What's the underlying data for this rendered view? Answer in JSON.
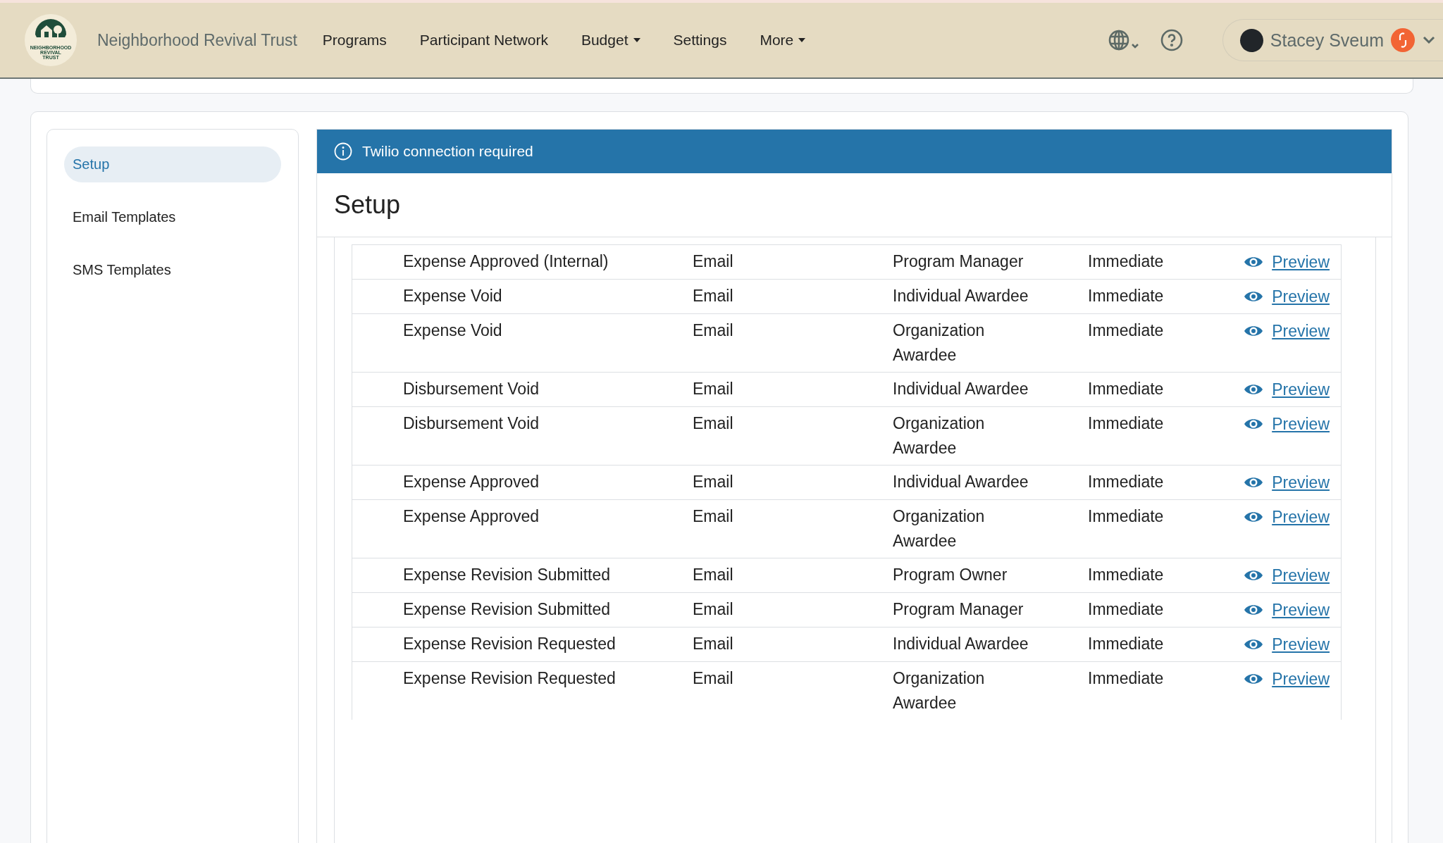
{
  "header": {
    "org_name": "Neighborhood Revival Trust",
    "logo_text": "NEIGHBORHOOD REVIVAL TRUST",
    "nav": [
      {
        "label": "Programs",
        "dropdown": false
      },
      {
        "label": "Participant Network",
        "dropdown": false
      },
      {
        "label": "Budget",
        "dropdown": true
      },
      {
        "label": "Settings",
        "dropdown": false
      },
      {
        "label": "More",
        "dropdown": true
      }
    ],
    "user": {
      "name": "Stacey Sveum"
    }
  },
  "sidebar": {
    "items": [
      {
        "label": "Setup",
        "selected": true
      },
      {
        "label": "Email Templates",
        "selected": false
      },
      {
        "label": "SMS Templates",
        "selected": false
      }
    ]
  },
  "banner": {
    "text": "Twilio connection required"
  },
  "title": "Setup",
  "rows": [
    {
      "name": "Expense Approved (Internal)",
      "type": "Email",
      "recipient": "Program Manager",
      "timing": "Immediate",
      "action": "Preview"
    },
    {
      "name": "Expense Void",
      "type": "Email",
      "recipient": "Individual Awardee",
      "timing": "Immediate",
      "action": "Preview"
    },
    {
      "name": "Expense Void",
      "type": "Email",
      "recipient": "Organization Awardee",
      "timing": "Immediate",
      "action": "Preview"
    },
    {
      "name": "Disbursement Void",
      "type": "Email",
      "recipient": "Individual Awardee",
      "timing": "Immediate",
      "action": "Preview"
    },
    {
      "name": "Disbursement Void",
      "type": "Email",
      "recipient": "Organization Awardee",
      "timing": "Immediate",
      "action": "Preview"
    },
    {
      "name": "Expense Approved",
      "type": "Email",
      "recipient": "Individual Awardee",
      "timing": "Immediate",
      "action": "Preview"
    },
    {
      "name": "Expense Approved",
      "type": "Email",
      "recipient": "Organization Awardee",
      "timing": "Immediate",
      "action": "Preview"
    },
    {
      "name": "Expense Revision Submitted",
      "type": "Email",
      "recipient": "Program Owner",
      "timing": "Immediate",
      "action": "Preview"
    },
    {
      "name": "Expense Revision Submitted",
      "type": "Email",
      "recipient": "Program Manager",
      "timing": "Immediate",
      "action": "Preview"
    },
    {
      "name": "Expense Revision Requested",
      "type": "Email",
      "recipient": "Individual Awardee",
      "timing": "Immediate",
      "action": "Preview"
    },
    {
      "name": "Expense Revision Requested",
      "type": "Email",
      "recipient": "Organization Awardee",
      "timing": "Immediate",
      "action": "Preview"
    }
  ]
}
